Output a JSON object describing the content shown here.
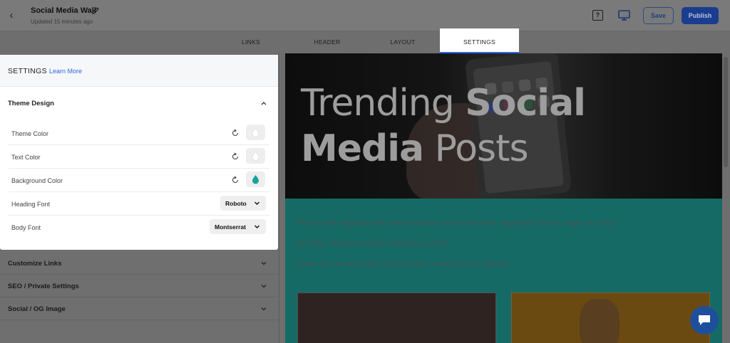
{
  "header": {
    "title": "Social Media Wall",
    "subtitle": "Updated 15 minutes ago",
    "save_label": "Save",
    "publish_label": "Publish",
    "help_label": "?"
  },
  "tabs": [
    {
      "label": "LINKS",
      "active": false
    },
    {
      "label": "HEADER",
      "active": false
    },
    {
      "label": "LAYOUT",
      "active": false
    },
    {
      "label": "SETTINGS",
      "active": true
    }
  ],
  "settings": {
    "heading": "SETTINGS",
    "learn_more": "Learn More",
    "theme_design": {
      "title": "Theme Design",
      "rows": [
        {
          "label": "Theme Color",
          "type": "color",
          "swatch_color": "#ffffff"
        },
        {
          "label": "Text Color",
          "type": "color",
          "swatch_color": "#ffffff"
        },
        {
          "label": "Background Color",
          "type": "color",
          "swatch_color": "#1aa39b"
        },
        {
          "label": "Heading Font",
          "type": "select",
          "value": "Roboto"
        },
        {
          "label": "Body Font",
          "type": "select",
          "value": "Montserrat"
        }
      ]
    },
    "sections": [
      {
        "label": "Customize Links"
      },
      {
        "label": "SEO / Private Settings"
      },
      {
        "label": "Social / OG Image"
      }
    ]
  },
  "preview": {
    "hero_title_light_1": "Trending ",
    "hero_title_bold_1": "Social",
    "hero_title_bold_2": "Media",
    "hero_title_light_2": " Posts",
    "paragraphs": [
      "Music is the language that unites everyone across the world, regardless of race, origin, or creed.",
      " So folks, what you've been waiting for is here...",
      "These are the best artists of this month, ranked by fans globally!"
    ],
    "background_color": "#1aa39b"
  },
  "colors": {
    "accent": "#2d66e0",
    "publish_bg": "#1a3d8f",
    "teal": "#1aa39b"
  }
}
